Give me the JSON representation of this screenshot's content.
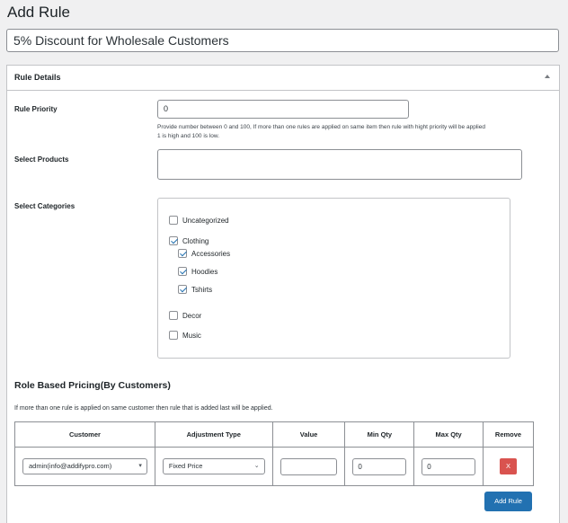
{
  "page": {
    "title": "Add Rule",
    "rule_title_value": "5% Discount for Wholesale Customers"
  },
  "rule_details": {
    "heading": "Rule Details",
    "priority": {
      "label": "Rule Priority",
      "value": "0",
      "help_line1": "Provide number between 0 and 100, If more than one rules are applied on same item then rule with hight priority will be applied",
      "help_line2": "1 is high and 100 is low."
    },
    "products": {
      "label": "Select Products",
      "value": ""
    },
    "categories": {
      "label": "Select Categories",
      "items": [
        {
          "label": "Uncategorized",
          "checked": false,
          "level": 0
        },
        {
          "label": "Clothing",
          "checked": true,
          "level": 0
        },
        {
          "label": "Accessories",
          "checked": true,
          "level": 1
        },
        {
          "label": "Hoodies",
          "checked": true,
          "level": 1
        },
        {
          "label": "Tshirts",
          "checked": true,
          "level": 1
        },
        {
          "label": "Decor",
          "checked": false,
          "level": 0
        },
        {
          "label": "Music",
          "checked": false,
          "level": 0
        }
      ]
    }
  },
  "role_pricing": {
    "heading": "Role Based Pricing(By Customers)",
    "note": "If more than one rule is applied on same customer then rule that is added last will be applied.",
    "columns": [
      "Customer",
      "Adjustment Type",
      "Value",
      "Min Qty",
      "Max Qty",
      "Remove"
    ],
    "rows": [
      {
        "customer": "admin(info@addifypro.com)",
        "adjustment_type": "Fixed Price",
        "value": "",
        "min_qty": "0",
        "max_qty": "0",
        "remove_label": "X"
      }
    ],
    "add_button": "Add Rule"
  },
  "colors": {
    "primary": "#2271b1",
    "danger": "#d9534f",
    "background": "#f0f0f1"
  }
}
